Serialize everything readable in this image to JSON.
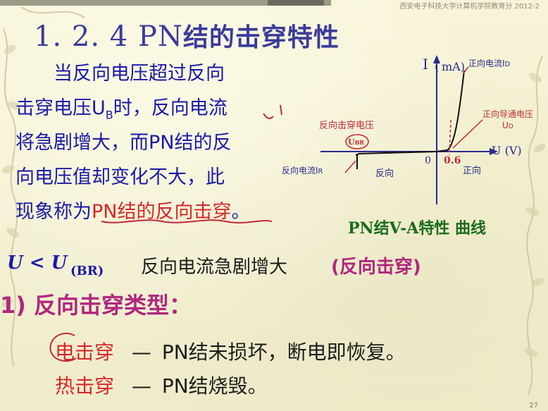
{
  "header": {
    "source_text": "西安电子科技大学计算机学院教育分 2012-2"
  },
  "title": {
    "number": "1. 2. 4",
    "prefix": "PN",
    "text": "结的击穿特性"
  },
  "paragraph": {
    "line1": "当反向电压超过反向",
    "line2a": "击穿电压U",
    "line2sub": "B",
    "line2b": "时，反向电流",
    "line3": "将急剧增大，而PN结的反",
    "line4": "向电压值却变化不大，此",
    "line5a": "现象称为",
    "line5b": "PN结的反向击穿",
    "line5c": "。"
  },
  "chart": {
    "y_axis_label": "I",
    "y_unit": "mA)",
    "y_paren_open": "(",
    "x_axis_label": "U (V)",
    "origin": "0",
    "threshold": "0.6",
    "breakdown_voltage_label": "U",
    "breakdown_voltage_sub": "BR",
    "forward_current_label": "正向电流I",
    "forward_current_sub": "D",
    "forward_voltage_label": "正向导通电压",
    "forward_voltage_symbol": "U",
    "forward_voltage_sub": "D",
    "reverse_breakdown_voltage_label": "反向击穿电压",
    "reverse_current_label": "反向电流I",
    "reverse_current_sub": "R",
    "reverse_region": "反向",
    "forward_region": "正向",
    "caption": "PN结V-A特性 曲线"
  },
  "formula": {
    "lhs": "U < U",
    "sub": "(BR)",
    "text": "反向电流急剧增大",
    "paren": "(反向击穿)"
  },
  "section": {
    "title": "1) 反向击穿类型："
  },
  "items": [
    {
      "term": "电击穿",
      "dash": "—",
      "desc": "PN结未损坏，断电即恢复。"
    },
    {
      "term": "热击穿",
      "dash": "—",
      "desc": "PN结烧毁。"
    }
  ],
  "page_number": "27",
  "colors": {
    "title": "#3b3b9a",
    "body_blue": "#1a1aa8",
    "accent_red": "#d4282a",
    "accent_magenta": "#b0287e",
    "caption_green": "#1a6b1a"
  }
}
